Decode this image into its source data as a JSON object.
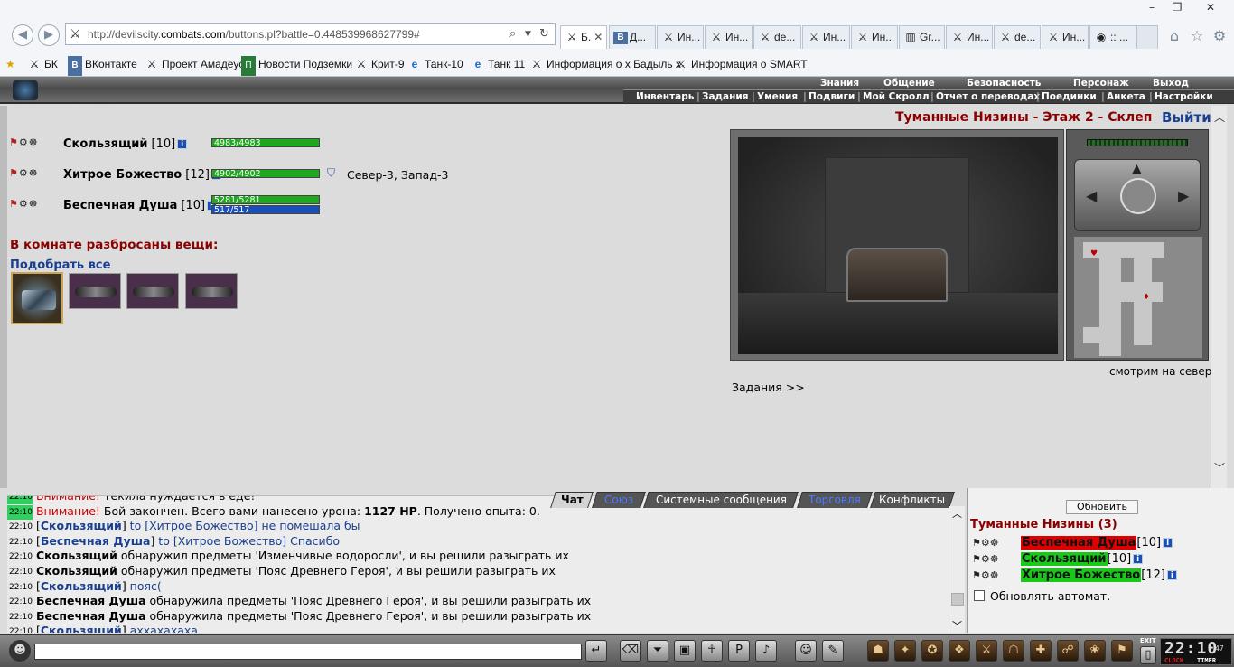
{
  "browser": {
    "url_prefix": "http://devilscity.",
    "url_domain": "combats.com",
    "url_rest": "/buttons.pl?battle=0.448539968627799#",
    "tabs": [
      {
        "label": "Б.",
        "active": true
      },
      {
        "label": "Д..."
      },
      {
        "label": "Ин..."
      },
      {
        "label": "Ин..."
      },
      {
        "label": "de..."
      },
      {
        "label": "Ин..."
      },
      {
        "label": "Ин..."
      },
      {
        "label": "Gr..."
      },
      {
        "label": "Ин..."
      },
      {
        "label": "de..."
      },
      {
        "label": "Ин..."
      },
      {
        "label": ":: ..."
      }
    ],
    "favorites": [
      {
        "label": "БК"
      },
      {
        "label": "ВКонтакте"
      },
      {
        "label": "Проект Амадеус"
      },
      {
        "label": "Новости Подземки"
      },
      {
        "label": "Крит-9"
      },
      {
        "label": "Танк-10"
      },
      {
        "label": "Танк 11"
      },
      {
        "label": "Информация о х Бадыль х"
      },
      {
        "label": "Информация о SMART"
      }
    ]
  },
  "game": {
    "logo": "DEVILSCITY",
    "top_menu": [
      "Знания",
      "Общение",
      "Безопасность",
      "Персонаж",
      "Выход"
    ],
    "sub_menu": [
      "Инвентарь",
      "Задания",
      "Умения",
      "Подвиги",
      "Мой Скролл",
      "Отчет о переводах",
      "Поединки",
      "Анкета",
      "Настройки"
    ],
    "location_title": "Туманные Низины - Этаж 2 - Склеп",
    "exit_link": "Выйти",
    "players": [
      {
        "name": "Скользящий",
        "level": "[10]",
        "hp": "4983/4983",
        "hp_fraction": 1.0
      },
      {
        "name": "Хитрое Божество",
        "level": "[12]",
        "hp": "4902/4902",
        "hp_fraction": 1.0,
        "coords": "Север-3, Запад-3"
      },
      {
        "name": "Беспечная Душа",
        "level": "[10]",
        "hp": "5281/5281",
        "hp_fraction": 1.0,
        "mp": "517/517",
        "mp_fraction": 1.0
      }
    ],
    "loot_title": "В комнате разбросаны вещи:",
    "pick_all": "Подобрать все",
    "facing": "смотрим на север",
    "quests_link": "Задания >>"
  },
  "chat": {
    "tabs": [
      "Чат",
      "Союз",
      "Системные сообщения",
      "Торговля",
      "Конфликты"
    ],
    "lines": [
      {
        "time": "22:10",
        "green": true,
        "parts": [
          {
            "c": "warn",
            "t": "Внимание!"
          },
          {
            "c": "",
            "t": " Текила нуждается в еде!"
          }
        ]
      },
      {
        "time": "22:10",
        "green": true,
        "parts": [
          {
            "c": "warn",
            "t": "Внимание!"
          },
          {
            "c": "",
            "t": " Бой закончен. Всего вами нанесено урона: "
          },
          {
            "c": "blk",
            "t": "1127 HP"
          },
          {
            "c": "",
            "t": ". Получено опыта: 0."
          }
        ]
      },
      {
        "time": "22:10",
        "green": false,
        "parts": [
          {
            "c": "",
            "t": "["
          },
          {
            "c": "nick",
            "t": "Скользящий"
          },
          {
            "c": "",
            "t": "] "
          },
          {
            "c": "to",
            "t": "to [Хитрое Божество] не помешала бы"
          }
        ]
      },
      {
        "time": "22:10",
        "green": false,
        "parts": [
          {
            "c": "",
            "t": "["
          },
          {
            "c": "nick",
            "t": "Беспечная Душа"
          },
          {
            "c": "",
            "t": "] "
          },
          {
            "c": "to",
            "t": "to [Хитрое Божество] Спасибо"
          }
        ]
      },
      {
        "time": "22:10",
        "green": false,
        "parts": [
          {
            "c": "blk",
            "t": "Скользящий"
          },
          {
            "c": "",
            "t": " обнаружил предметы 'Изменчивые водоросли', и вы решили разыграть их"
          }
        ]
      },
      {
        "time": "22:10",
        "green": false,
        "parts": [
          {
            "c": "blk",
            "t": "Скользящий"
          },
          {
            "c": "",
            "t": " обнаружил предметы 'Пояс Древнего Героя', и вы решили разыграть их"
          }
        ]
      },
      {
        "time": "22:10",
        "green": false,
        "parts": [
          {
            "c": "",
            "t": "["
          },
          {
            "c": "nick",
            "t": "Скользящий"
          },
          {
            "c": "",
            "t": "] "
          },
          {
            "c": "to",
            "t": "пояс("
          }
        ]
      },
      {
        "time": "22:10",
        "green": false,
        "parts": [
          {
            "c": "blk",
            "t": "Беспечная Душа"
          },
          {
            "c": "",
            "t": " обнаружила предметы 'Пояс Древнего Героя', и вы решили разыграть их"
          }
        ]
      },
      {
        "time": "22:10",
        "green": false,
        "parts": [
          {
            "c": "blk",
            "t": "Беспечная Душа"
          },
          {
            "c": "",
            "t": " обнаружила предметы 'Пояс Древнего Героя', и вы решили разыграть их"
          }
        ]
      },
      {
        "time": "22:10",
        "green": false,
        "parts": [
          {
            "c": "",
            "t": "["
          },
          {
            "c": "nick",
            "t": "Скользящий"
          },
          {
            "c": "",
            "t": "] "
          },
          {
            "c": "to",
            "t": "аххахахаха"
          }
        ]
      }
    ]
  },
  "room_panel": {
    "refresh": "Обновить",
    "title": "Туманные Низины (3)",
    "members": [
      {
        "name": "Беспечная Душа",
        "level": "[10]",
        "style": "red"
      },
      {
        "name": "Скользящий",
        "level": "[10]",
        "style": "grn"
      },
      {
        "name": "Хитрое Божество",
        "level": "[12]",
        "style": "grn"
      }
    ],
    "auto_refresh": "Обновлять автомат."
  },
  "bottom": {
    "clock": "22:10",
    "clock_sec": "47",
    "clock_label": "CLOCK",
    "timer_label": "TIMER",
    "exit_label": "EXIT"
  },
  "colors": {
    "location": "#8b0000",
    "link": "#1a3f8f",
    "hp": "#1fa81f",
    "mp": "#1a4fb5"
  }
}
